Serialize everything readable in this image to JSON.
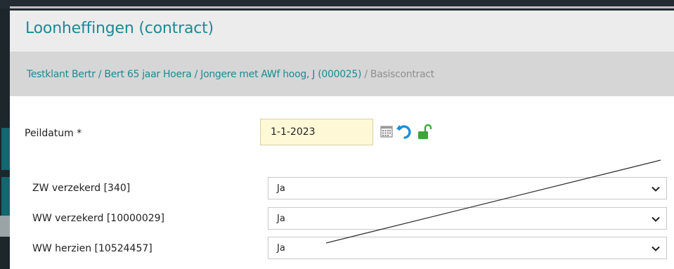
{
  "page": {
    "title": "Loonheffingen (contract)"
  },
  "breadcrumb": {
    "client": "Testklant Bertr",
    "employee": "Bert 65 jaar Hoera",
    "group": "Jongere met AWf hoog, J (000025)",
    "contract": "Basiscontract"
  },
  "peildatum": {
    "label": "Peildatum *",
    "value": "1-1-2023"
  },
  "fields": [
    {
      "label": "ZW verzekerd [340]",
      "value": "Ja"
    },
    {
      "label": "WW verzekerd [10000029]",
      "value": "Ja"
    },
    {
      "label": "WW herzien [10524457]",
      "value": "Ja"
    }
  ],
  "icons": {
    "calendar": "calendar-icon",
    "undo": "undo-icon",
    "lock": "unlock-icon",
    "chevron": "chevron-down-icon"
  },
  "colors": {
    "accent": "#1b8a93",
    "date_bg": "#fff8d6",
    "lock_green": "#3aa635",
    "undo_blue": "#1c8fd8"
  }
}
